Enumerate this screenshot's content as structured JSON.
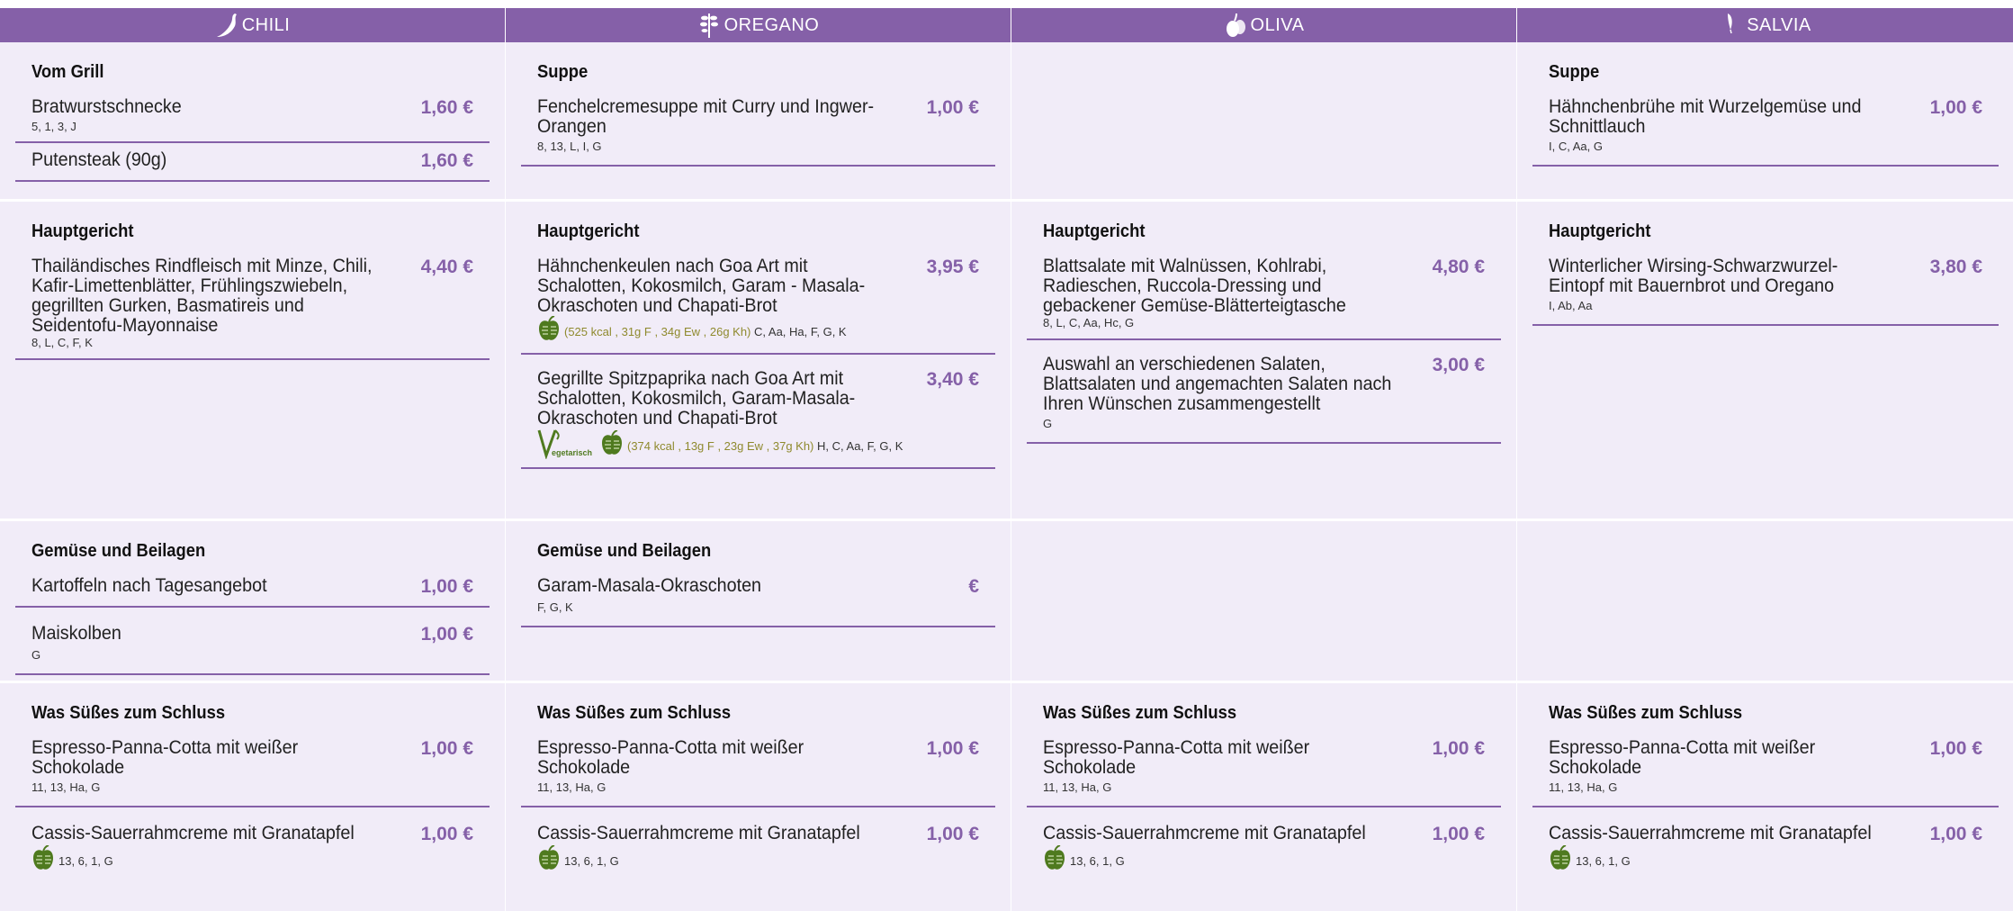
{
  "columns": [
    {
      "name": "CHILI",
      "icon": "chili-icon"
    },
    {
      "name": "OREGANO",
      "icon": "oregano-icon"
    },
    {
      "name": "OLIVA",
      "icon": "olive-icon"
    },
    {
      "name": "SALVIA",
      "icon": "sage-icon"
    }
  ],
  "rows": {
    "r1": {
      "chili": {
        "section": "Vom Grill",
        "items": [
          {
            "name": "Bratwurstschnecke",
            "price": "1,60 €",
            "allergens": "5, 1, 3, J"
          },
          {
            "name": "Putensteak (90g)",
            "price": "1,60 €"
          }
        ]
      },
      "oregano": {
        "section": "Suppe",
        "items": [
          {
            "name": "Fenchelcremesuppe mit Curry und Ingwer-Orangen",
            "price": "1,00 €",
            "allergens": "8, 13, L, I, G"
          }
        ]
      },
      "salvia": {
        "section": "Suppe",
        "items": [
          {
            "name": "Hähnchenbrühe mit Wurzelgemüse und Schnittlauch",
            "price": "1,00 €",
            "allergens": "I, C, Aa, G"
          }
        ]
      }
    },
    "r2": {
      "chili": {
        "section": "Hauptgericht",
        "items": [
          {
            "name": "Thailändisches Rindfleisch mit Minze, Chili, Kafir-Limettenblätter, Frühlingszwiebeln, gegrillten Gurken, Basmatireis und Seidentofu-Mayonnaise",
            "price": "4,40 €",
            "allergens": "8, L, C, F, K"
          }
        ]
      },
      "oregano": {
        "section": "Hauptgericht",
        "items": [
          {
            "name": "Hähnchenkeulen nach Goa Art mit Schalotten, Kokosmilch, Garam - Masala-Okraschoten und Chapati-Brot",
            "price": "3,95 €",
            "nutrition": "(525 kcal , 31g F , 34g Ew , 26g Kh)",
            "allergens": "C, Aa, Ha, F, G, K"
          },
          {
            "name": "Gegrillte Spitzpaprika nach Goa Art mit Schalotten, Kokosmilch, Garam-Masala-Okraschoten und Chapati-Brot",
            "price": "3,40 €",
            "veg_label": "egetarisch",
            "nutrition": "(374 kcal , 13g F , 23g Ew , 37g Kh)",
            "allergens": "H, C, Aa, F, G, K"
          }
        ]
      },
      "oliva": {
        "section": "Hauptgericht",
        "items": [
          {
            "name": "Blattsalate mit Walnüssen, Kohlrabi, Radieschen, Ruccola-Dressing und gebackener Gemüse-Blätterteigtasche",
            "price": "4,80 €",
            "allergens": "8, L, C, Aa, Hc, G"
          },
          {
            "name": "Auswahl an verschiedenen Salaten, Blattsalaten und angemachten Salaten nach Ihren Wünschen zusammengestellt",
            "price": "3,00 €",
            "allergens": "G"
          }
        ]
      },
      "salvia": {
        "section": "Hauptgericht",
        "items": [
          {
            "name": "Winterlicher Wirsing-Schwarzwurzel-Eintopf mit Bauernbrot und Oregano",
            "price": "3,80 €",
            "allergens": "I, Ab, Aa"
          }
        ]
      }
    },
    "r3": {
      "chili": {
        "section": "Gemüse und Beilagen",
        "items": [
          {
            "name": "Kartoffeln nach Tagesangebot",
            "price": "1,00 €"
          },
          {
            "name": "Maiskolben",
            "price": "1,00 €",
            "allergens": "G"
          }
        ]
      },
      "oregano": {
        "section": "Gemüse und Beilagen",
        "items": [
          {
            "name": "Garam-Masala-Okraschoten",
            "price": "€",
            "allergens": "F, G, K"
          }
        ]
      }
    },
    "r4": {
      "dessert": {
        "section": "Was Süßes zum Schluss",
        "items": [
          {
            "name": "Espresso-Panna-Cotta mit weißer Schokolade",
            "price": "1,00 €",
            "allergens": "11, 13, Ha, G"
          },
          {
            "name": "Cassis-Sauerrahmcreme mit Granatapfel",
            "price": "1,00 €",
            "allergens": "13, 6, 1, G"
          }
        ]
      }
    }
  },
  "colors": {
    "accent": "#8560a8",
    "cell_bg": "#f1ecf8",
    "nutrition": "#8f8a2e",
    "leaf": "#4f7a1f"
  }
}
